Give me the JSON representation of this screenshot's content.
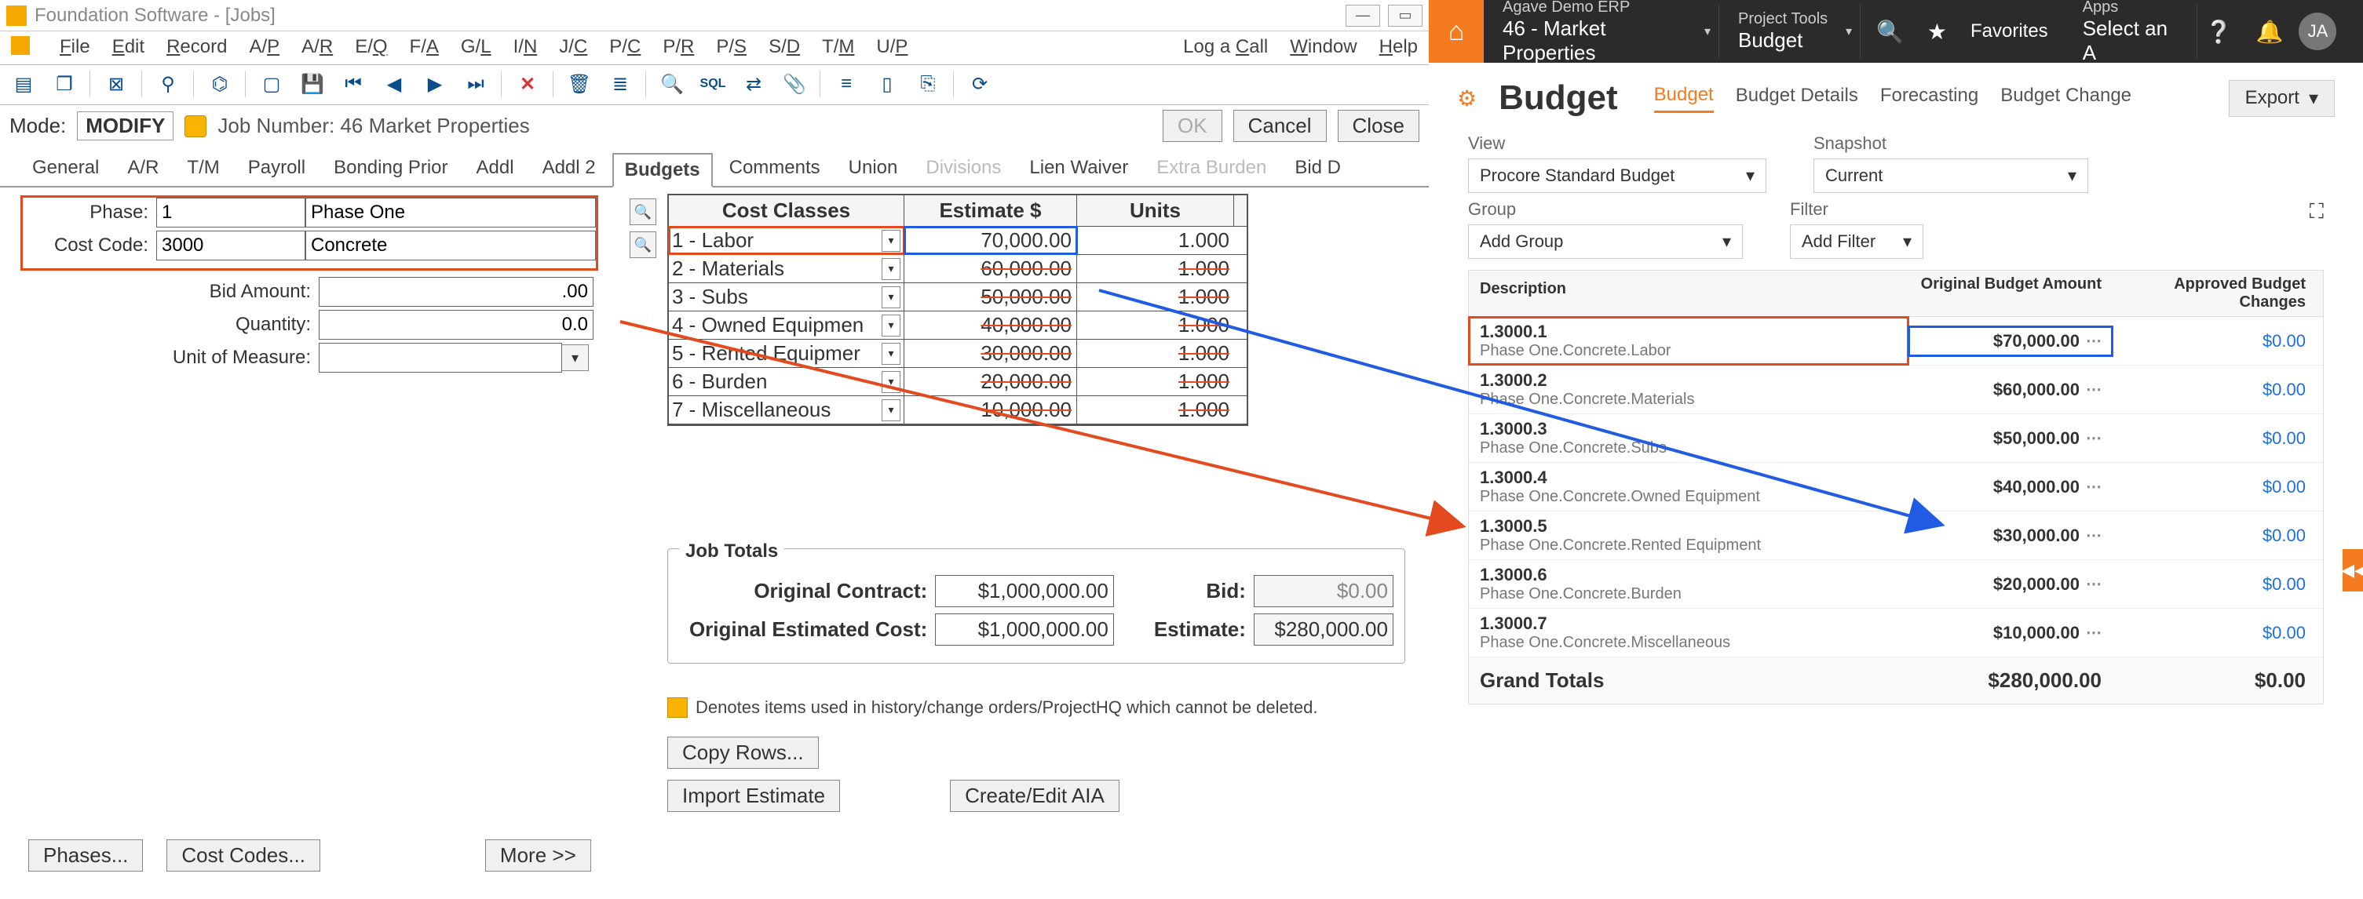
{
  "fs": {
    "title": "Foundation Software - [Jobs]",
    "menus": [
      "File",
      "Edit",
      "Record",
      "A/P",
      "A/R",
      "E/Q",
      "F/A",
      "G/L",
      "I/N",
      "J/C",
      "P/C",
      "P/R",
      "P/S",
      "S/D",
      "T/M",
      "U/P"
    ],
    "menu_right": [
      "Log a Call",
      "Window",
      "Help"
    ],
    "mode_label": "Mode:",
    "mode_value": "MODIFY",
    "job_label": "Job Number: 46  Market Properties",
    "buttons": {
      "ok": "OK",
      "cancel": "Cancel",
      "close": "Close"
    },
    "tabs": [
      "General",
      "A/R",
      "T/M",
      "Payroll",
      "Bonding Prior",
      "Addl",
      "Addl 2",
      "Budgets",
      "Comments",
      "Union",
      "Divisions",
      "Lien Waiver",
      "Extra Burden",
      "Bid D"
    ],
    "active_tab": 7,
    "dim_tabs": [
      10,
      12
    ],
    "form": {
      "phase_label": "Phase:",
      "phase_code": "1",
      "phase_name": "Phase One",
      "cost_code_label": "Cost Code:",
      "cost_code": "3000",
      "cost_name": "Concrete",
      "bid_amount_label": "Bid Amount:",
      "bid_amount": ".00",
      "qty_label": "Quantity:",
      "qty": "0.0",
      "uom_label": "Unit of Measure:",
      "uom": ""
    },
    "cost_table": {
      "headers": [
        "Cost Classes",
        "Estimate $",
        "Units"
      ],
      "rows": [
        {
          "cls": "1  - Labor",
          "est": "70,000.00",
          "units": "1.000"
        },
        {
          "cls": "2  - Materials",
          "est": "60,000.00",
          "units": "1.000"
        },
        {
          "cls": "3  - Subs",
          "est": "50,000.00",
          "units": "1.000"
        },
        {
          "cls": "4  - Owned Equipmen",
          "est": "40,000.00",
          "units": "1.000"
        },
        {
          "cls": "5  - Rented Equipmer",
          "est": "30,000.00",
          "units": "1.000"
        },
        {
          "cls": "6  - Burden",
          "est": "20,000.00",
          "units": "1.000"
        },
        {
          "cls": "7  - Miscellaneous",
          "est": "10,000.00",
          "units": "1.000"
        }
      ]
    },
    "jobtotals": {
      "title": "Job Totals",
      "oc_label": "Original Contract:",
      "oc_val": "$1,000,000.00",
      "oec_label": "Original Estimated Cost:",
      "oec_val": "$1,000,000.00",
      "bid_label": "Bid:",
      "bid_val": "$0.00",
      "est_label": "Estimate:",
      "est_val": "$280,000.00"
    },
    "note": "Denotes items used in history/change orders/ProjectHQ which cannot be deleted.",
    "copy_rows": "Copy Rows...",
    "import_estimate": "Import Estimate",
    "create_aia": "Create/Edit AIA",
    "phases_btn": "Phases...",
    "ccodes_btn": "Cost Codes...",
    "more_btn": "More >>"
  },
  "pc": {
    "top": {
      "erp_small": "Agave Demo ERP",
      "erp": "46 - Market Properties",
      "tools_small": "Project Tools",
      "tools": "Budget",
      "fav": "Favorites",
      "apps_small": "Apps",
      "apps": "Select an A",
      "avatar": "JA"
    },
    "h1": "Budget",
    "tabs": [
      "Budget",
      "Budget Details",
      "Forecasting",
      "Budget Change"
    ],
    "export": "Export",
    "filters": {
      "view_label": "View",
      "view_val": "Procore Standard Budget",
      "snap_label": "Snapshot",
      "snap_val": "Current",
      "group_label": "Group",
      "group_val": "Add Group",
      "filter_label": "Filter",
      "filter_val": "Add Filter"
    },
    "table": {
      "h1": "Description",
      "h2": "Original Budget Amount",
      "h3": "Approved Budget Changes",
      "rows": [
        {
          "code": "1.3000.1",
          "desc": "Phase One.Concrete.Labor",
          "amt": "$70,000.00",
          "chg": "$0.00"
        },
        {
          "code": "1.3000.2",
          "desc": "Phase One.Concrete.Materials",
          "amt": "$60,000.00",
          "chg": "$0.00"
        },
        {
          "code": "1.3000.3",
          "desc": "Phase One.Concrete.Subs",
          "amt": "$50,000.00",
          "chg": "$0.00"
        },
        {
          "code": "1.3000.4",
          "desc": "Phase One.Concrete.Owned Equipment",
          "amt": "$40,000.00",
          "chg": "$0.00"
        },
        {
          "code": "1.3000.5",
          "desc": "Phase One.Concrete.Rented Equipment",
          "amt": "$30,000.00",
          "chg": "$0.00"
        },
        {
          "code": "1.3000.6",
          "desc": "Phase One.Concrete.Burden",
          "amt": "$20,000.00",
          "chg": "$0.00"
        },
        {
          "code": "1.3000.7",
          "desc": "Phase One.Concrete.Miscellaneous",
          "amt": "$10,000.00",
          "chg": "$0.00"
        }
      ],
      "gt_label": "Grand Totals",
      "gt_amt": "$280,000.00",
      "gt_chg": "$0.00"
    }
  }
}
